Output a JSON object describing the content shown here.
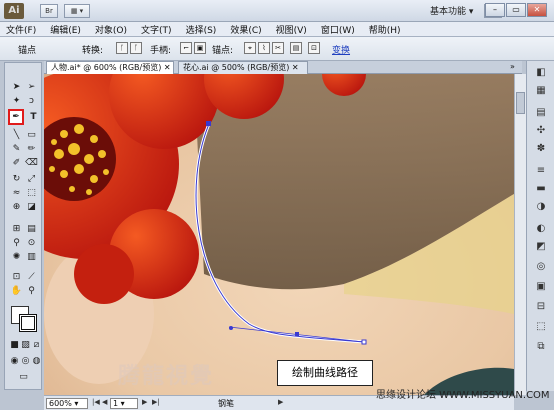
{
  "app": {
    "logo": "Ai",
    "workspace": "基本功能"
  },
  "menu": [
    "文件(F)",
    "编辑(E)",
    "对象(O)",
    "文字(T)",
    "选择(S)",
    "效果(C)",
    "视图(V)",
    "窗口(W)",
    "帮助(H)"
  ],
  "controlbar": {
    "anchor_label": "锚点",
    "convert_label": "转换:",
    "handle_label": "手柄:",
    "anchor2_label": "锚点:",
    "link_label": "变换"
  },
  "tabs": [
    {
      "label": "人物.ai* @ 600% (RGB/预览)",
      "active": true
    },
    {
      "label": "花心.ai @ 500% (RGB/预览)",
      "active": false
    }
  ],
  "status": {
    "zoom": "600%",
    "page": "1",
    "tool": "钢笔"
  },
  "caption": "绘制曲线路径",
  "watermark": {
    "logo_text": "腾龍視覺",
    "site": "思缘设计论坛  WWW.MISSYUAN.COM"
  },
  "icons": {
    "active_tool": "pen-tool-icon"
  },
  "colors": {
    "highlight": "#e01b1b",
    "path": "#3a3ad0",
    "flower": "#e23515"
  }
}
